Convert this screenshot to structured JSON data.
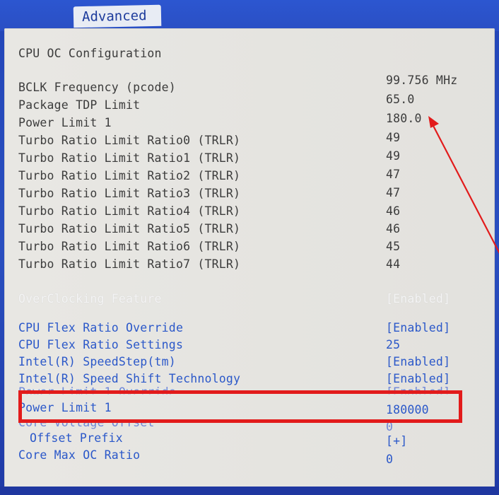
{
  "tab": {
    "label": "Advanced"
  },
  "page": {
    "title": "CPU OC Configuration"
  },
  "readouts": [
    {
      "label": "BCLK Frequency (pcode)",
      "value": "99.756 MHz"
    },
    {
      "label": "Package TDP Limit",
      "value": "65.0"
    },
    {
      "label": "Power Limit 1",
      "value": "180.0"
    },
    {
      "label": "Turbo Ratio Limit Ratio0 (TRLR)",
      "value": "49"
    },
    {
      "label": "Turbo Ratio Limit Ratio1 (TRLR)",
      "value": "49"
    },
    {
      "label": "Turbo Ratio Limit Ratio2 (TRLR)",
      "value": "47"
    },
    {
      "label": "Turbo Ratio Limit Ratio3 (TRLR)",
      "value": "47"
    },
    {
      "label": "Turbo Ratio Limit Ratio4 (TRLR)",
      "value": "46"
    },
    {
      "label": "Turbo Ratio Limit Ratio5 (TRLR)",
      "value": "46"
    },
    {
      "label": "Turbo Ratio Limit Ratio6 (TRLR)",
      "value": "45"
    },
    {
      "label": "Turbo Ratio Limit Ratio7 (TRLR)",
      "value": "44"
    }
  ],
  "selected_option": {
    "label": "OverClocking Feature",
    "value": "[Enabled]"
  },
  "settings": [
    {
      "label": "CPU Flex Ratio Override",
      "value": "[Enabled]"
    },
    {
      "label": "CPU Flex Ratio Settings",
      "value": "25"
    },
    {
      "label": "Intel(R) SpeedStep(tm)",
      "value": "[Enabled]"
    },
    {
      "label": "Intel(R) Speed Shift Technology",
      "value": "[Enabled]"
    },
    {
      "label": "Power Limit 1 Override",
      "value": "[Enabled]"
    },
    {
      "label": "Power Limit 1",
      "value": "180000"
    },
    {
      "label": "Core Voltage Offset",
      "value": "0"
    },
    {
      "label": "Offset Prefix",
      "value": "[+]"
    },
    {
      "label": "Core Max OC Ratio",
      "value": "0"
    }
  ],
  "colors": {
    "frame_blue": "#2346b8",
    "panel_bg": "#e7e6e2",
    "readonly_text": "#3c3c3c",
    "option_text": "#2b58c9",
    "annotation_red": "#e21b1b"
  }
}
